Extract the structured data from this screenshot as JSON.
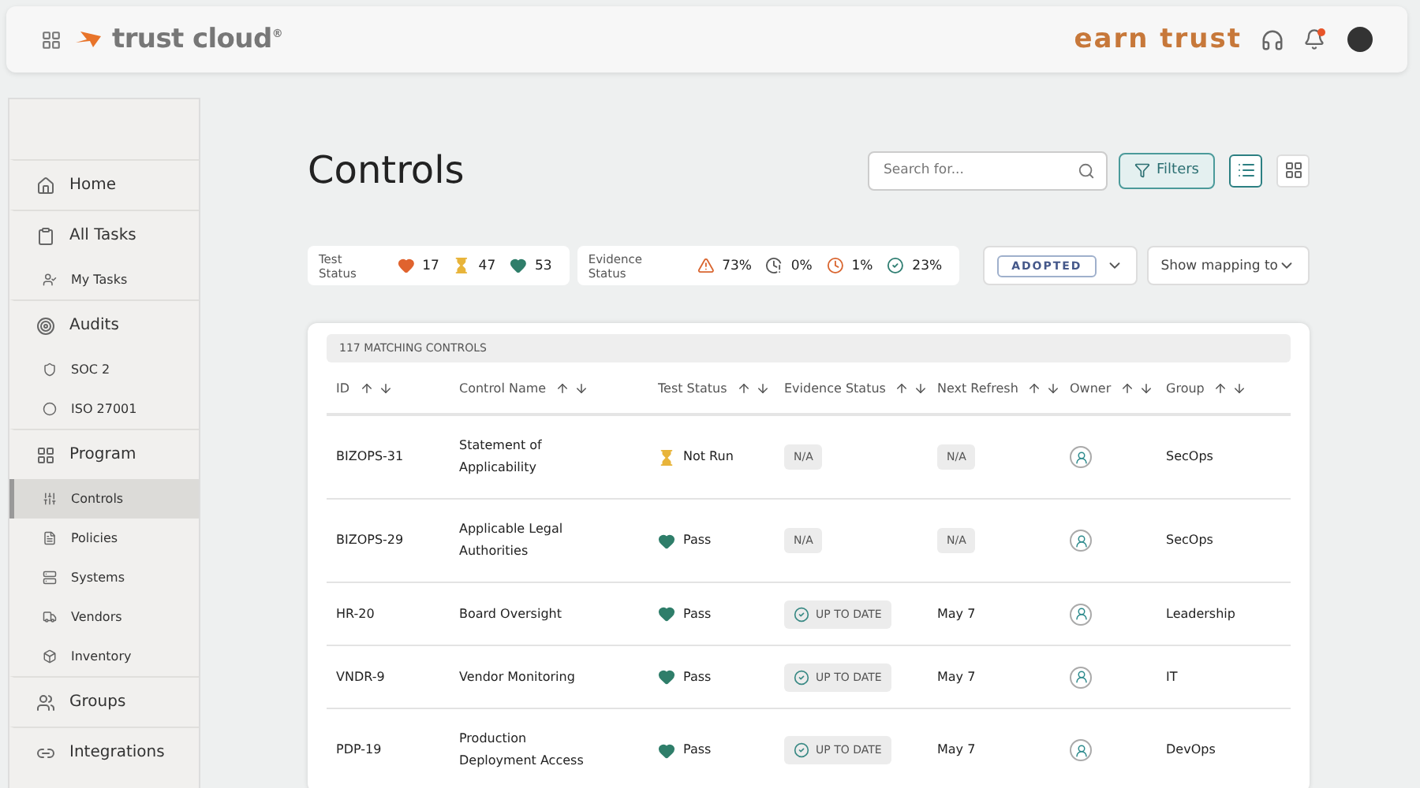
{
  "header": {
    "logo": "trust cloud",
    "logo_mark": "®",
    "tagline": "earn trust",
    "notifications_unread": true
  },
  "sidebar": {
    "items": [
      {
        "label": "Home",
        "selected": false
      },
      {
        "label": "All Tasks",
        "selected": false,
        "children": [
          {
            "label": "My Tasks",
            "selected": false
          }
        ]
      },
      {
        "label": "Audits",
        "selected": false,
        "children": [
          {
            "label": "SOC 2",
            "selected": false
          },
          {
            "label": "ISO 27001",
            "selected": false
          }
        ]
      },
      {
        "label": "Program",
        "selected": false,
        "children": [
          {
            "label": "Controls",
            "selected": true
          },
          {
            "label": "Policies",
            "selected": false
          },
          {
            "label": "Systems",
            "selected": false
          },
          {
            "label": "Vendors",
            "selected": false
          },
          {
            "label": "Inventory",
            "selected": false
          }
        ]
      },
      {
        "label": "Groups",
        "selected": false
      },
      {
        "label": "Integrations",
        "selected": false
      }
    ]
  },
  "page": {
    "title": "Controls",
    "search": {
      "placeholder": "Search for..."
    },
    "filters_button": "Filters",
    "view_modes": [
      {
        "kind": "list",
        "selected": true
      },
      {
        "kind": "grid",
        "selected": false
      }
    ]
  },
  "test_status": {
    "label": "Test Status",
    "counts": [
      {
        "kind": "fail",
        "value": "17"
      },
      {
        "kind": "not_run",
        "value": "47"
      },
      {
        "kind": "pass",
        "value": "53"
      }
    ]
  },
  "evidence_status": {
    "label": "Evidence Status",
    "counts": [
      {
        "kind": "warning",
        "value": "73%"
      },
      {
        "kind": "expired",
        "value": "0%"
      },
      {
        "kind": "pending",
        "value": "1%"
      },
      {
        "kind": "up_to_date",
        "value": "23%"
      }
    ]
  },
  "adopted_select": {
    "value": "ADOPTED"
  },
  "mapping_select": {
    "value": "Show mapping to"
  },
  "table": {
    "summary": "117 MATCHING CONTROLS",
    "columns": [
      "ID",
      "Control Name",
      "Test Status",
      "Evidence Status",
      "Next Refresh",
      "Owner",
      "Group"
    ],
    "rows": [
      {
        "id": "BIZOPS-31",
        "name": "Statement of Applicability",
        "test": {
          "kind": "not_run",
          "text": "Not Run"
        },
        "evidence": {
          "kind": "na",
          "text": "N/A"
        },
        "refresh": {
          "kind": "badge",
          "text": "N/A"
        },
        "group": "SecOps"
      },
      {
        "id": "BIZOPS-29",
        "name": "Applicable Legal Authorities",
        "test": {
          "kind": "pass",
          "text": "Pass"
        },
        "evidence": {
          "kind": "na",
          "text": "N/A"
        },
        "refresh": {
          "kind": "badge",
          "text": "N/A"
        },
        "group": "SecOps"
      },
      {
        "id": "HR-20",
        "name": "Board Oversight",
        "test": {
          "kind": "pass",
          "text": "Pass"
        },
        "evidence": {
          "kind": "up_to_date",
          "text": "UP TO DATE"
        },
        "refresh": {
          "kind": "plain",
          "text": "May 7"
        },
        "group": "Leadership"
      },
      {
        "id": "VNDR-9",
        "name": "Vendor Monitoring",
        "test": {
          "kind": "pass",
          "text": "Pass"
        },
        "evidence": {
          "kind": "up_to_date",
          "text": "UP TO DATE"
        },
        "refresh": {
          "kind": "plain",
          "text": "May 7"
        },
        "group": "IT"
      },
      {
        "id": "PDP-19",
        "name": "Production Deployment Access",
        "test": {
          "kind": "pass",
          "text": "Pass"
        },
        "evidence": {
          "kind": "up_to_date",
          "text": "UP TO DATE"
        },
        "refresh": {
          "kind": "plain",
          "text": "May 7"
        },
        "group": "DevOps"
      }
    ]
  }
}
